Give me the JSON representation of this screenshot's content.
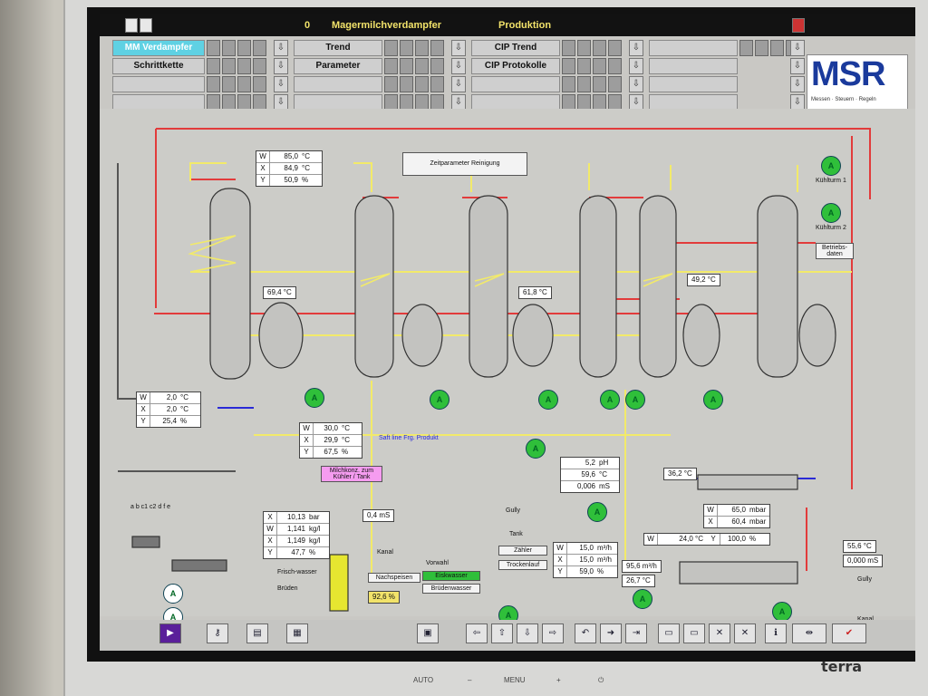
{
  "header": {
    "number": "0",
    "title": "Magermilchverdampfer",
    "mode": "Produktion"
  },
  "nav": {
    "mm": "MM Verdampfer",
    "schrittkette": "Schrittkette",
    "trend": "Trend",
    "parameter": "Parameter",
    "cip_trend": "CIP Trend",
    "cip_protokolle": "CIP Protokolle"
  },
  "logo": {
    "text": "MSR",
    "sub": "Messen · Steuern · Regeln"
  },
  "reset_btn": "Zeitparameter Reinigung",
  "box1": {
    "w": "85,0",
    "x": "84,9",
    "y": "50,9",
    "u1": "°C",
    "u3": "%"
  },
  "t1": "69,4  °C",
  "t2": "61,8  °C",
  "t3": "49,2  °C",
  "box2": {
    "w": "2,0",
    "x": "2,0",
    "y": "25,4",
    "u1": "°C",
    "u3": "%"
  },
  "box3": {
    "w": "30,0",
    "x": "29,9",
    "y": "67,5",
    "u1": "°C",
    "u3": "%"
  },
  "saftlabel": "Saft line Frg. Produkt",
  "ph_box": {
    "a": "5,2",
    "au": "pH",
    "b": "59,6",
    "bu": "°C",
    "c": "0,006",
    "cu": "mS"
  },
  "milch_btn": "Milchkonz. zum Kühler / Tank",
  "box4": {
    "x": "10,13",
    "xu": "bar",
    "w": "1,141",
    "wu": "kg/l",
    "x2": "1,149",
    "x2u": "kg/l",
    "y": "47,7",
    "yu": "%"
  },
  "ms1": "0,4   mS",
  "kanal": "Kanal",
  "nach": "Nachspeisen",
  "lvl": "92,6   %",
  "vorwahl": "Vorwahl",
  "vw1": "Eiskwasser",
  "vw2": "Brüdenwasser",
  "zahler": "Zähler",
  "trocken": "Trockenlauf",
  "box5": {
    "w": "15,0",
    "x": "15,0",
    "y": "59,0",
    "u": "m³/h",
    "yu": "%"
  },
  "t4": "36,2   °C",
  "box6": {
    "w": "65,0",
    "x": "60,4",
    "y": "100,0",
    "u": "mbar",
    "yu": "%"
  },
  "t5": "24,0   °C",
  "box7": {
    "a": "95,6  m³/h",
    "b": "26,7   °C"
  },
  "box8": {
    "a": "55,6  °C",
    "b": "0,000  mS"
  },
  "kuhl1": "Kühlturm 1",
  "kuhl2": "Kühlturm 2",
  "betrieb": "Betriebs-daten",
  "guly": "Gully",
  "tank": "Tank",
  "gully2": "Gully",
  "kanal2": "Kanal",
  "abc": "a  b  c1 c2    d  f  e",
  "frisch": "Frisch-wasser",
  "bruden": "Brüden",
  "brand": "terra",
  "controls": {
    "auto": "AUTO",
    "minus": "–",
    "menu": "MENU",
    "plus": "+"
  },
  "colors": {
    "red": "#e23b3b",
    "yellow": "#f2ea6a",
    "green": "#2fbf3a",
    "blue": "#2a2ad6"
  }
}
